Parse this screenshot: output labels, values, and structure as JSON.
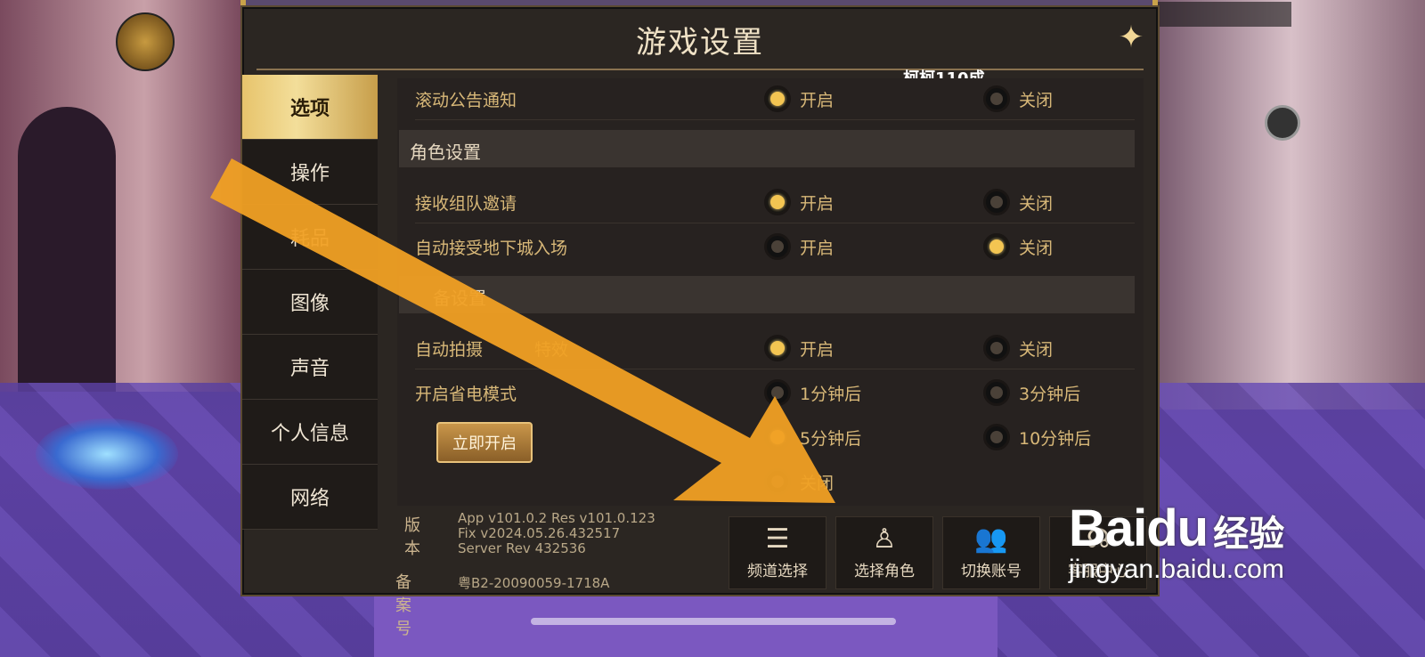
{
  "title": "游戏设置",
  "player_name": "柯柯110成",
  "nav": [
    {
      "label": "选项",
      "active": true
    },
    {
      "label": "操作",
      "active": false
    },
    {
      "label": "耗品",
      "active": false
    },
    {
      "label": "图像",
      "active": false
    },
    {
      "label": "声音",
      "active": false
    },
    {
      "label": "个人信息",
      "active": false
    },
    {
      "label": "网络",
      "active": false
    }
  ],
  "settings": {
    "scroll_notice": {
      "label": "滚动公告通知",
      "opt_on": "开启",
      "opt_off": "关闭",
      "value": "开启"
    },
    "role_section": "角色设置",
    "team_invite": {
      "label": "接收组队邀请",
      "opt_on": "开启",
      "opt_off": "关闭",
      "value": "开启"
    },
    "dungeon_accept": {
      "label": "自动接受地下城入场",
      "opt_on": "开启",
      "opt_off": "关闭",
      "value": "关闭"
    },
    "device_section": "备设置",
    "auto_capture": {
      "label": "自动拍摄",
      "label_tail": "特效",
      "opt_on": "开启",
      "opt_off": "关闭",
      "value": "开启"
    },
    "power_save": {
      "label": "开启省电模式",
      "options": [
        "1分钟后",
        "3分钟后",
        "5分钟后",
        "10分钟后",
        "关闭"
      ],
      "value": "5分钟后",
      "now_button": "立即开启"
    }
  },
  "footer": {
    "version_label": "版本",
    "version_lines": [
      "App v101.0.2 Res v101.0.123",
      "Fix v2024.05.26.432517",
      "Server Rev 432536"
    ],
    "icp_label": "备案号",
    "icp_text": "粤B2-20090059-1718A",
    "buttons": [
      {
        "label": "频道选择",
        "icon": "list-icon"
      },
      {
        "label": "选择角色",
        "icon": "character-icon"
      },
      {
        "label": "切换账号",
        "icon": "users-icon"
      },
      {
        "label": "客服中心",
        "icon": "headset-icon"
      }
    ]
  },
  "watermark": {
    "logo": "Baidu",
    "logo_tail": "经验",
    "url": "jingyan.baidu.com"
  },
  "colors": {
    "accent": "#f3c552",
    "label": "#d8b878",
    "arrow": "#f0a024"
  }
}
